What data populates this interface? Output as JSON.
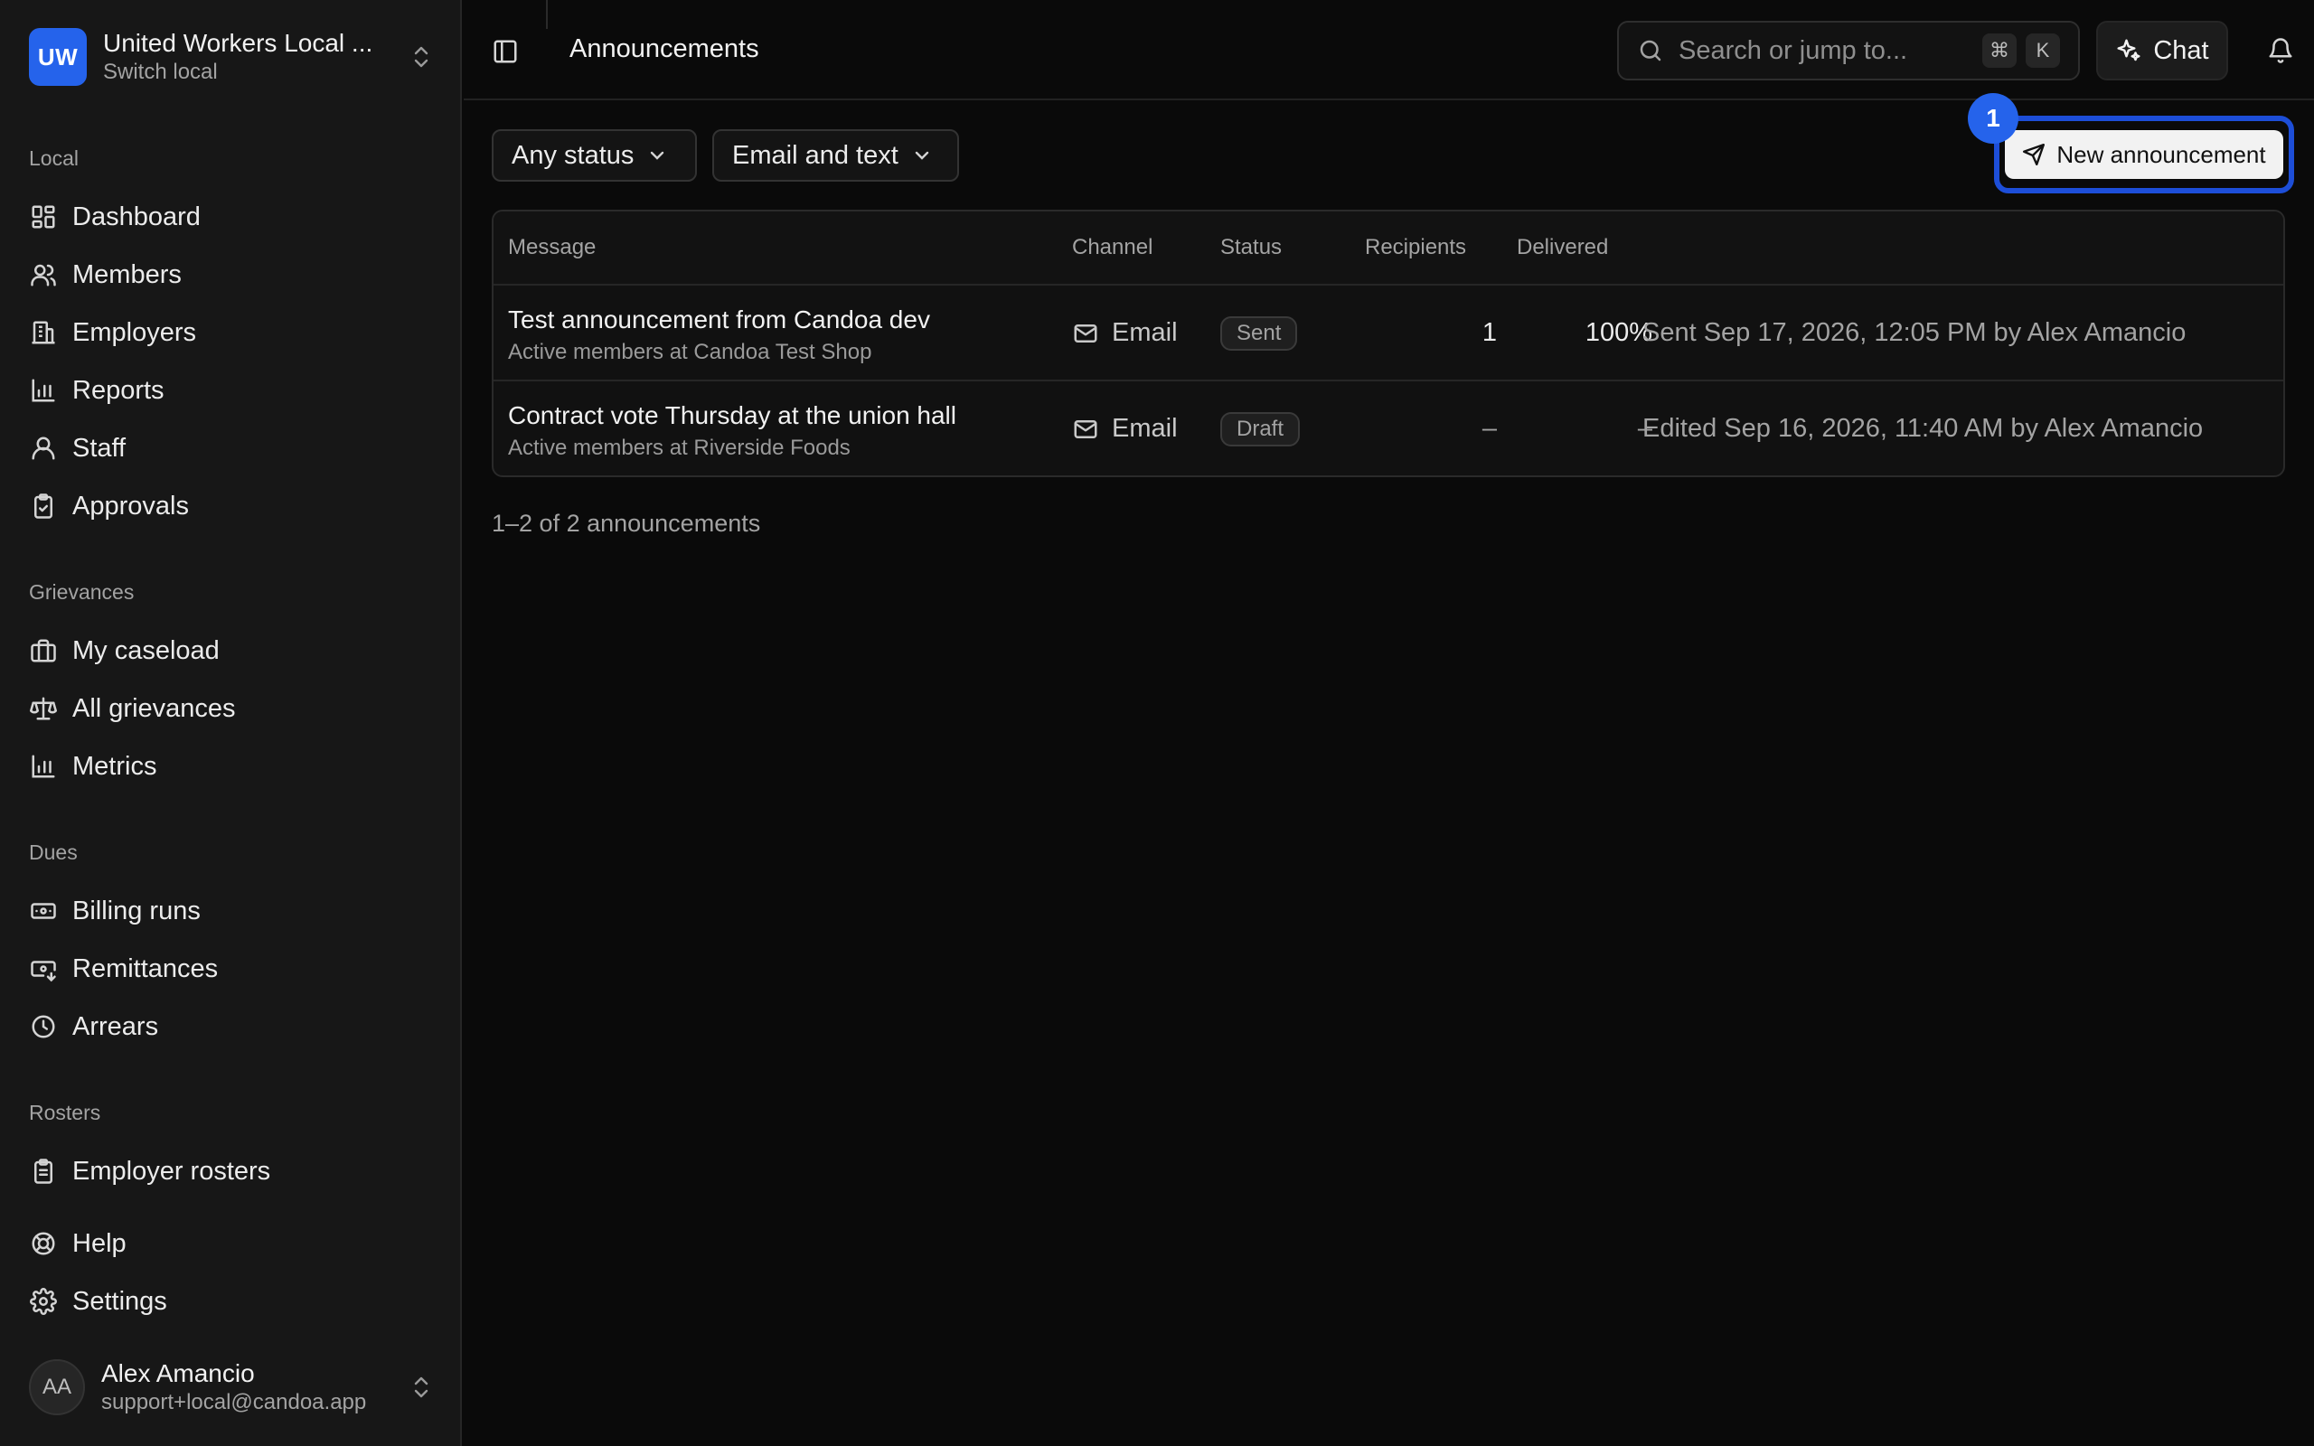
{
  "org": {
    "initials": "UW",
    "name": "United Workers Local ...",
    "switch_label": "Switch local"
  },
  "sidebar": {
    "sections": {
      "local": "Local",
      "grievances": "Grievances",
      "dues": "Dues",
      "rosters": "Rosters"
    },
    "items": {
      "dashboard": "Dashboard",
      "members": "Members",
      "employers": "Employers",
      "reports": "Reports",
      "staff": "Staff",
      "approvals": "Approvals",
      "my_caseload": "My caseload",
      "all_grievances": "All grievances",
      "metrics": "Metrics",
      "billing_runs": "Billing runs",
      "remittances": "Remittances",
      "arrears": "Arrears",
      "employer_rosters": "Employer rosters",
      "help": "Help",
      "settings": "Settings"
    }
  },
  "user": {
    "initials": "AA",
    "name": "Alex Amancio",
    "email": "support+local@candoa.app"
  },
  "header": {
    "title": "Announcements",
    "search_placeholder": "Search or jump to...",
    "kbd_cmd": "⌘",
    "kbd_k": "K",
    "chat_label": "Chat"
  },
  "filters": {
    "status": "Any status",
    "channel": "Email and text"
  },
  "new_button": {
    "label": "New announcement",
    "step_badge": "1",
    "accent": "#2563eb"
  },
  "table": {
    "columns": {
      "message": "Message",
      "channel": "Channel",
      "status": "Status",
      "recipients": "Recipients",
      "delivered": "Delivered"
    },
    "rows": [
      {
        "title": "Test announcement from Candoa dev",
        "audience": "Active members at Candoa Test Shop",
        "channel": "Email",
        "status": "Sent",
        "recipients": "1",
        "delivered": "100%",
        "meta": "Sent Sep 17, 2026, 12:05 PM by Alex Amancio"
      },
      {
        "title": "Contract vote Thursday at the union hall",
        "audience": "Active members at Riverside Foods",
        "channel": "Email",
        "status": "Draft",
        "recipients": "–",
        "delivered": "–",
        "meta": "Edited Sep 16, 2026, 11:40 AM by Alex Amancio"
      }
    ]
  },
  "pagination": {
    "summary": "1–2 of 2 announcements"
  }
}
